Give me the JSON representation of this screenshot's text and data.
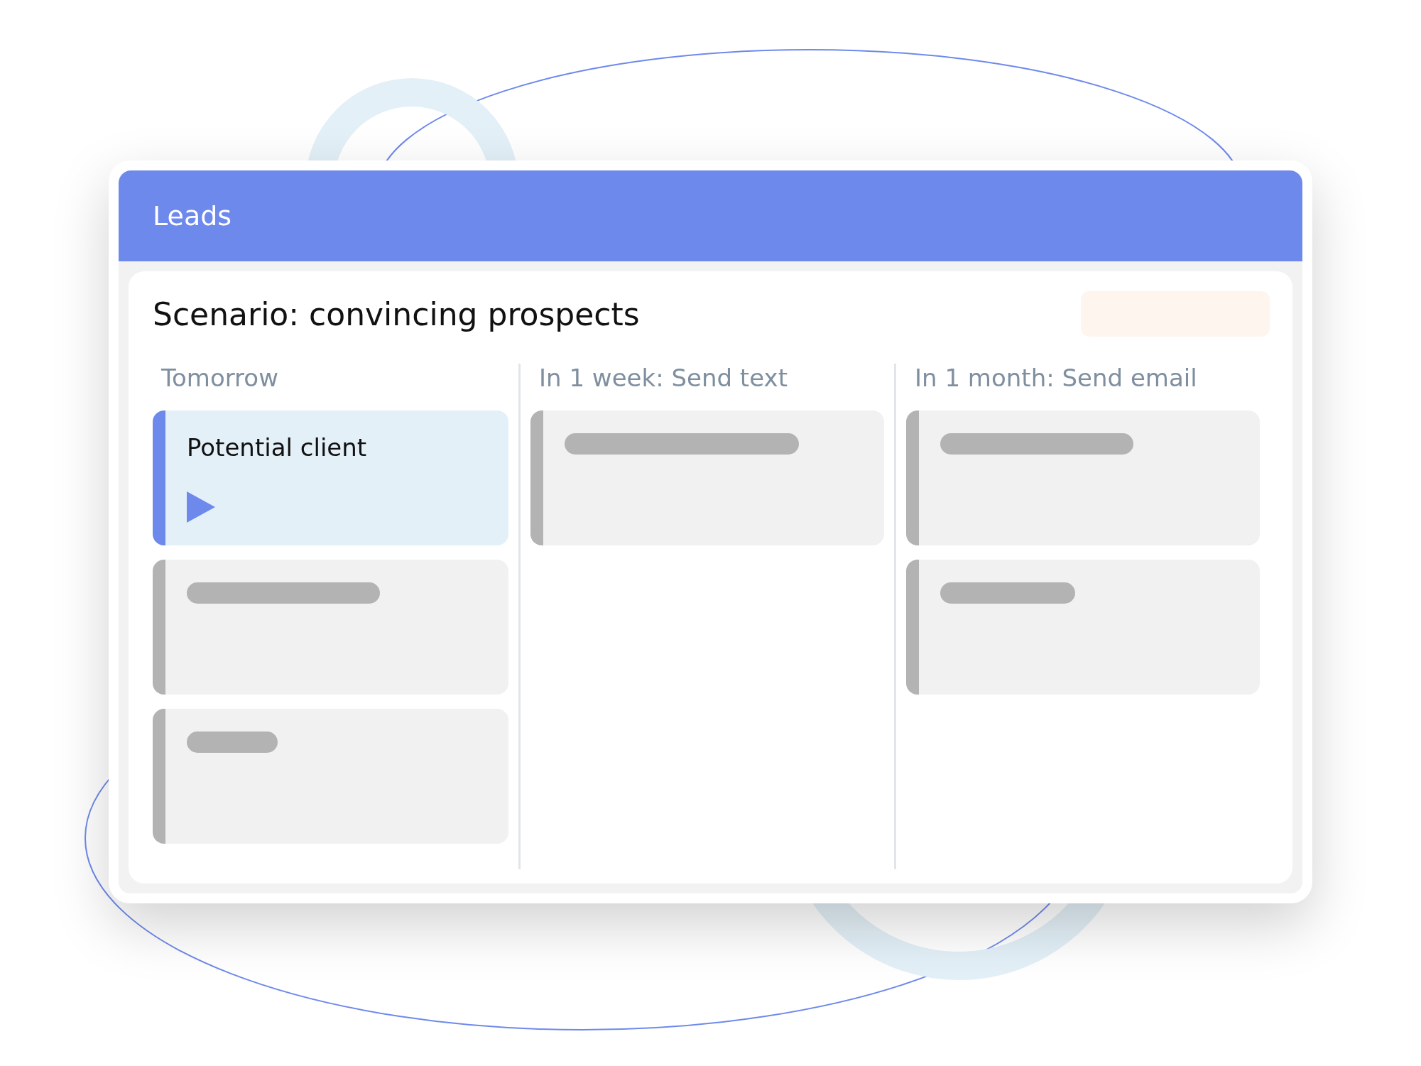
{
  "window": {
    "title": "Leads"
  },
  "board": {
    "title": "Scenario: convincing prospects",
    "columns": [
      {
        "title": "Tomorrow",
        "cards": [
          {
            "kind": "lead",
            "title": "Potential client",
            "selected": true
          },
          {
            "kind": "skeleton",
            "selected": false
          },
          {
            "kind": "skeleton",
            "selected": false
          }
        ]
      },
      {
        "title": "In 1 week: Send text",
        "cards": [
          {
            "kind": "skeleton",
            "selected": false
          }
        ]
      },
      {
        "title": "In 1 month: Send email",
        "cards": [
          {
            "kind": "skeleton",
            "selected": false
          },
          {
            "kind": "skeleton",
            "selected": false
          }
        ]
      }
    ]
  }
}
